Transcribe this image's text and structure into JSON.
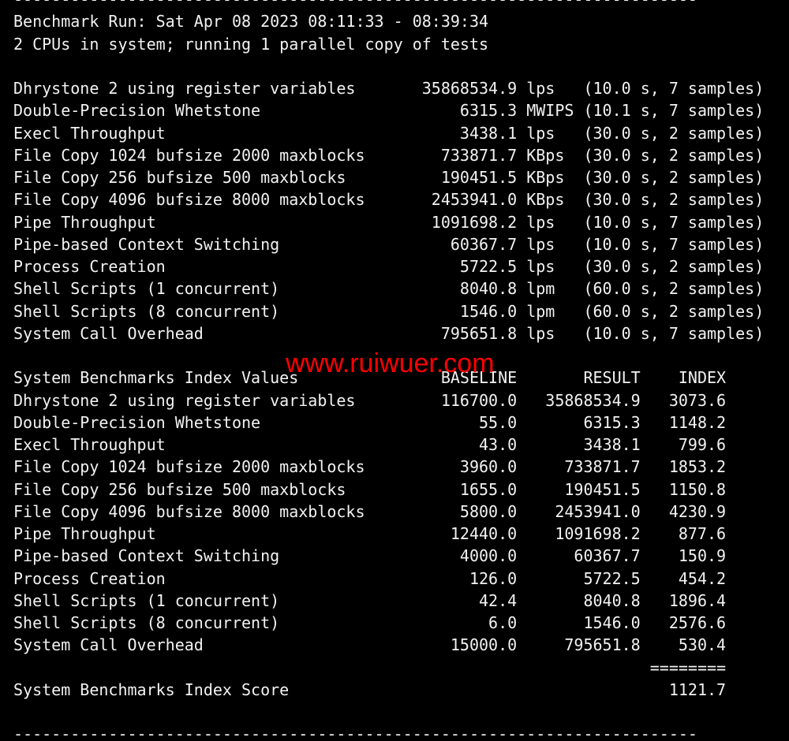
{
  "terminal": {
    "colors": {
      "background": "#000000",
      "foreground": "#f2f2f2"
    },
    "divider": {
      "char": "-",
      "length": 72
    },
    "header": {
      "run_line": "Benchmark Run: Sat Apr 08 2023 08:11:33 - 08:39:34",
      "cpu_line": "2 CPUs in system; running 1 parallel copy of tests"
    },
    "results": {
      "rows": [
        {
          "name": "Dhrystone 2 using register variables",
          "value": "35868534.9",
          "unit": "lps",
          "duration": "10.0",
          "samples": "7"
        },
        {
          "name": "Double-Precision Whetstone",
          "value": "6315.3",
          "unit": "MWIPS",
          "duration": "10.1",
          "samples": "7"
        },
        {
          "name": "Execl Throughput",
          "value": "3438.1",
          "unit": "lps",
          "duration": "30.0",
          "samples": "2"
        },
        {
          "name": "File Copy 1024 bufsize 2000 maxblocks",
          "value": "733871.7",
          "unit": "KBps",
          "duration": "30.0",
          "samples": "2"
        },
        {
          "name": "File Copy 256 bufsize 500 maxblocks",
          "value": "190451.5",
          "unit": "KBps",
          "duration": "30.0",
          "samples": "2"
        },
        {
          "name": "File Copy 4096 bufsize 8000 maxblocks",
          "value": "2453941.0",
          "unit": "KBps",
          "duration": "30.0",
          "samples": "2"
        },
        {
          "name": "Pipe Throughput",
          "value": "1091698.2",
          "unit": "lps",
          "duration": "10.0",
          "samples": "7"
        },
        {
          "name": "Pipe-based Context Switching",
          "value": "60367.7",
          "unit": "lps",
          "duration": "10.0",
          "samples": "7"
        },
        {
          "name": "Process Creation",
          "value": "5722.5",
          "unit": "lps",
          "duration": "30.0",
          "samples": "2"
        },
        {
          "name": "Shell Scripts (1 concurrent)",
          "value": "8040.8",
          "unit": "lpm",
          "duration": "60.0",
          "samples": "2"
        },
        {
          "name": "Shell Scripts (8 concurrent)",
          "value": "1546.0",
          "unit": "lpm",
          "duration": "60.0",
          "samples": "2"
        },
        {
          "name": "System Call Overhead",
          "value": "795651.8",
          "unit": "lps",
          "duration": "10.0",
          "samples": "7"
        }
      ]
    },
    "index_table": {
      "title": "System Benchmarks Index Values",
      "columns": [
        "BASELINE",
        "RESULT",
        "INDEX"
      ],
      "rows": [
        {
          "name": "Dhrystone 2 using register variables",
          "baseline": "116700.0",
          "result": "35868534.9",
          "index": "3073.6"
        },
        {
          "name": "Double-Precision Whetstone",
          "baseline": "55.0",
          "result": "6315.3",
          "index": "1148.2"
        },
        {
          "name": "Execl Throughput",
          "baseline": "43.0",
          "result": "3438.1",
          "index": "799.6"
        },
        {
          "name": "File Copy 1024 bufsize 2000 maxblocks",
          "baseline": "3960.0",
          "result": "733871.7",
          "index": "1853.2"
        },
        {
          "name": "File Copy 256 bufsize 500 maxblocks",
          "baseline": "1655.0",
          "result": "190451.5",
          "index": "1150.8"
        },
        {
          "name": "File Copy 4096 bufsize 8000 maxblocks",
          "baseline": "5800.0",
          "result": "2453941.0",
          "index": "4230.9"
        },
        {
          "name": "Pipe Throughput",
          "baseline": "12440.0",
          "result": "1091698.2",
          "index": "877.6"
        },
        {
          "name": "Pipe-based Context Switching",
          "baseline": "4000.0",
          "result": "60367.7",
          "index": "150.9"
        },
        {
          "name": "Process Creation",
          "baseline": "126.0",
          "result": "5722.5",
          "index": "454.2"
        },
        {
          "name": "Shell Scripts (1 concurrent)",
          "baseline": "42.4",
          "result": "8040.8",
          "index": "1896.4"
        },
        {
          "name": "Shell Scripts (8 concurrent)",
          "baseline": "6.0",
          "result": "1546.0",
          "index": "2576.6"
        },
        {
          "name": "System Call Overhead",
          "baseline": "15000.0",
          "result": "795651.8",
          "index": "530.4"
        }
      ],
      "separator": "========",
      "score_label": "System Benchmarks Index Score",
      "score": "1121.7"
    }
  },
  "watermark": {
    "text": "www.ruiwuer.com",
    "color": "#ff0000"
  }
}
